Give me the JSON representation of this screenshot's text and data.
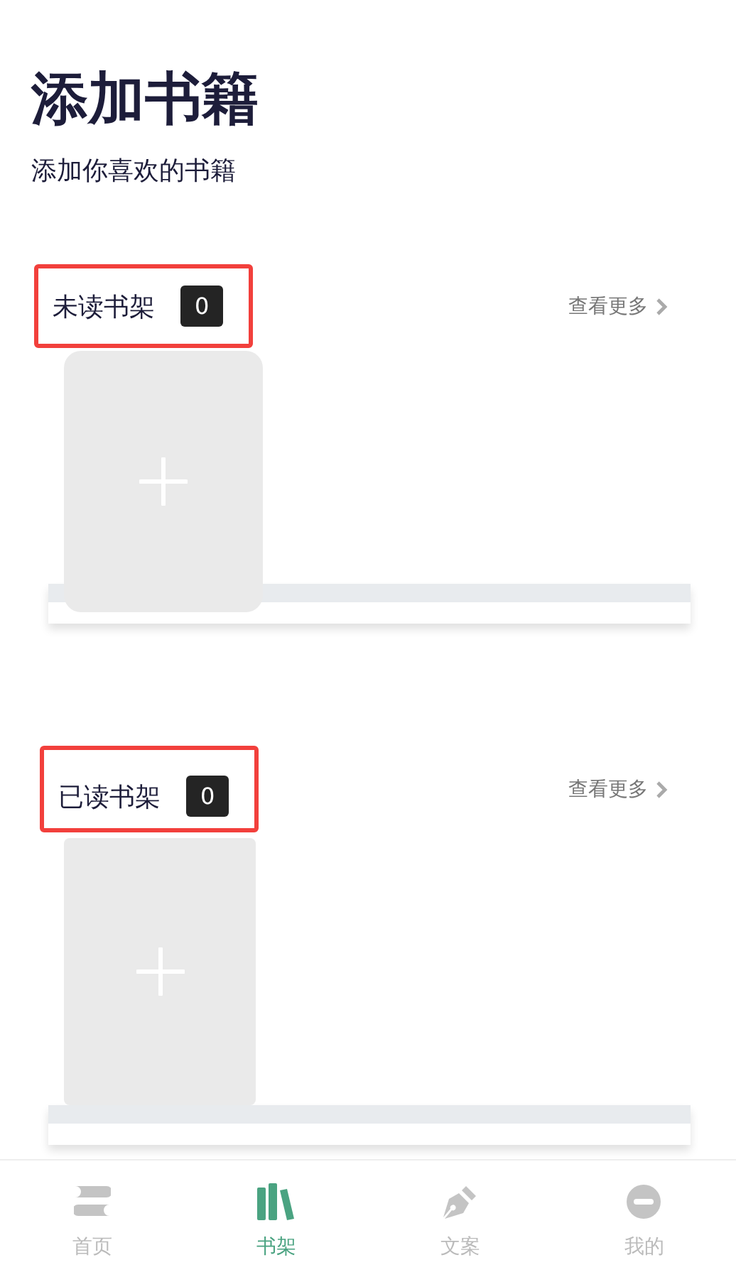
{
  "title": "添加书籍",
  "subtitle": "添加你喜欢的书籍",
  "shelves": [
    {
      "title": "未读书架",
      "count": "0",
      "more": "查看更多",
      "highlighted": true
    },
    {
      "title": "已读书架",
      "count": "0",
      "more": "查看更多",
      "highlighted": true
    }
  ],
  "tabs": [
    {
      "label": "首页",
      "kind": "home",
      "selected": false
    },
    {
      "label": "书架",
      "kind": "books",
      "selected": true
    },
    {
      "label": "文案",
      "kind": "pen",
      "selected": false
    },
    {
      "label": "我的",
      "kind": "face",
      "selected": false
    }
  ]
}
